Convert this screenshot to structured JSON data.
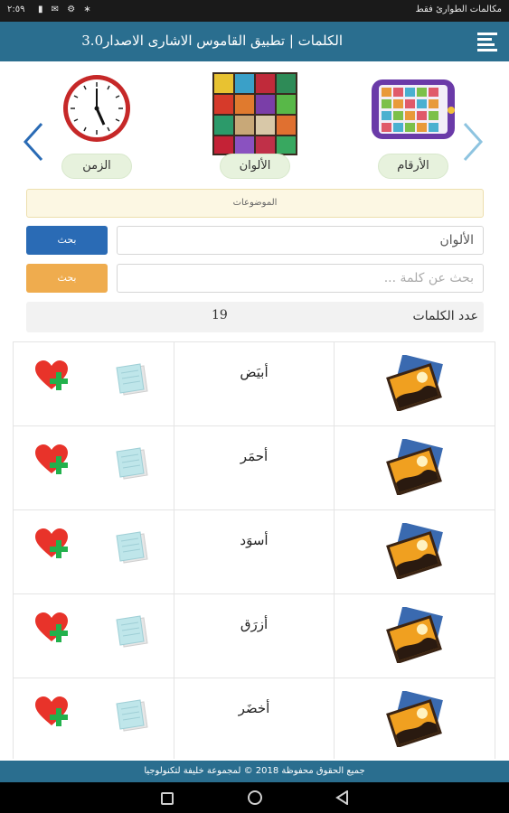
{
  "status_bar": {
    "time": "٢:٥٩",
    "carrier": "مكالمات الطوارئ فقط"
  },
  "header": {
    "title": "الكلمات | تطبيق القاموس الاشارى الاصدار3.0",
    "menu_icon": "hamburger-icon"
  },
  "topics": [
    {
      "label": "الزمن",
      "icon": "clock-icon"
    },
    {
      "label": "الألوان",
      "icon": "color-blocks-icon"
    },
    {
      "label": "الأرقام",
      "icon": "numbers-tablet-icon"
    }
  ],
  "subjects_label": "الموضوعات",
  "topic_field": {
    "value": "الألوان"
  },
  "search": {
    "placeholder": "بحث عن كلمة ..."
  },
  "buttons": {
    "search_topic": "بحث",
    "search_word": "بحث"
  },
  "word_count": {
    "label": "عدد الكلمات",
    "value": "19"
  },
  "words": [
    {
      "word": "أبيَض"
    },
    {
      "word": "أحمَر"
    },
    {
      "word": "أسوَد"
    },
    {
      "word": "أزرَق"
    },
    {
      "word": "أخضَر"
    }
  ],
  "footer": "جميع الحقوق محفوظة 2018 © لمجموعة خليفة لتكنولوجيا",
  "colors": {
    "primary": "#2a6e8f",
    "button_blue": "#2a6bb5",
    "button_orange": "#efac4e",
    "topic_label_bg": "#e7f2dd",
    "subjects_bg": "#fcf7e3"
  }
}
